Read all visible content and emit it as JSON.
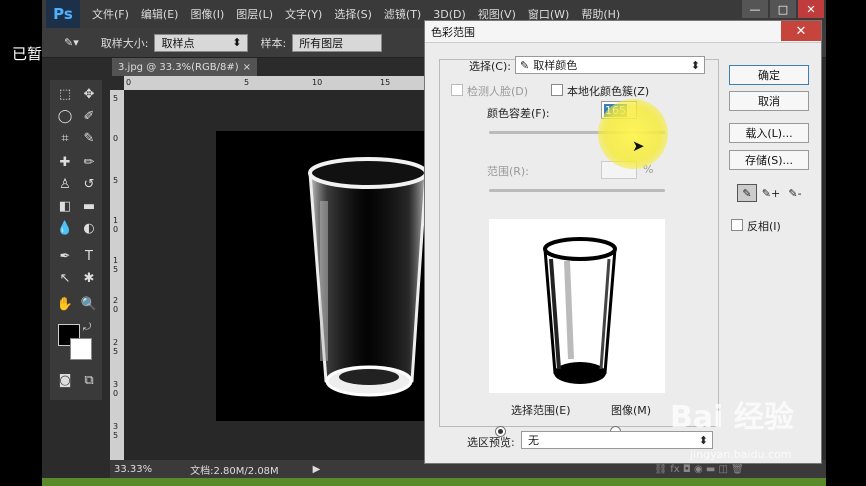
{
  "overlay": {
    "paused": "已暂停"
  },
  "app": {
    "logo": "Ps",
    "menu": [
      "文件(F)",
      "编辑(E)",
      "图像(I)",
      "图层(L)",
      "文字(Y)",
      "选择(S)",
      "滤镜(T)",
      "3D(D)",
      "视图(V)",
      "窗口(W)",
      "帮助(H)"
    ],
    "window_controls": {
      "minimize": "—",
      "restore": "□",
      "close": "✕"
    }
  },
  "options_bar": {
    "sample_size_label": "取样大小:",
    "sample_size_value": "取样点",
    "sample_label": "样本:",
    "sample_value": "所有图层"
  },
  "document": {
    "tab_title": "3.jpg @ 33.3%(RGB/8#)",
    "tab_close": "×",
    "ruler_h": [
      "0",
      "5",
      "10",
      "15"
    ],
    "ruler_v": [
      "5",
      "0",
      "5",
      "1\n0",
      "1\n5",
      "2\n0",
      "2\n5",
      "3\n0",
      "3\n5"
    ]
  },
  "status": {
    "zoom": "33.33%",
    "doc_info": "文档:2.80M/2.08M",
    "arrow": "▶"
  },
  "dialog": {
    "title": "色彩范围",
    "close": "✕",
    "select_label": "选择(C):",
    "select_value": "取样颜色",
    "detect_faces": "检测人脸(D)",
    "localized_clusters": "本地化颜色簇(Z)",
    "fuzziness_label": "颜色容差(F):",
    "fuzziness_value": "165",
    "range_label": "范围(R):",
    "range_unit": "%",
    "radio_selection": "选择范围(E)",
    "radio_image": "图像(M)",
    "preview_label": "选区预览:",
    "preview_value": "无",
    "buttons": {
      "ok": "确定",
      "cancel": "取消",
      "load": "载入(L)...",
      "save": "存储(S)..."
    },
    "invert": "反相(I)"
  },
  "watermark": {
    "text": "Bai  经验",
    "url": "jingyan.baidu.com"
  },
  "colors": {
    "accent": "#3c7fb1",
    "highlight": "#f4ea48",
    "close_red": "#c7443c"
  }
}
